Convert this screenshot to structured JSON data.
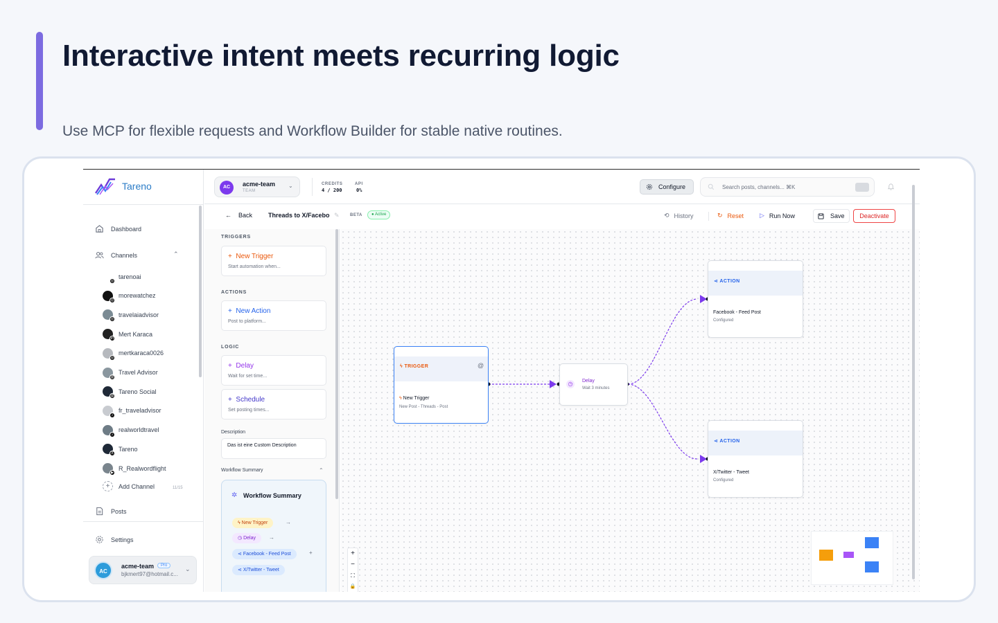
{
  "hero": {
    "headline": "Interactive intent meets recurring logic",
    "subline": "Use MCP for flexible requests and Workflow Builder for stable native routines."
  },
  "colors": {
    "accent": "#7c6be0",
    "brand": "#2b7cc7",
    "trigger": "#f97316",
    "action": "#2563eb",
    "logic": "#9333ea",
    "danger": "#dc2626",
    "connector": "#7c3aed"
  },
  "sidebar": {
    "brand": "Tareno",
    "nav": {
      "dashboard": "Dashboard",
      "channels": "Channels",
      "posts": "Posts",
      "settings": "Settings"
    },
    "channels": [
      {
        "name": "tarenoai",
        "badge": "instagram",
        "avatar_color": "#ffffff"
      },
      {
        "name": "morewatchez",
        "badge": "instagram",
        "avatar_color": "#111111"
      },
      {
        "name": "travelaiadvisor",
        "badge": "instagram",
        "avatar_color": "#7b8b94"
      },
      {
        "name": "Mert Karaca",
        "badge": "linkedin",
        "avatar_color": "#222222"
      },
      {
        "name": "mertkaraca0026",
        "badge": "instagram",
        "avatar_color": "#b6b9be"
      },
      {
        "name": "Travel Advisor",
        "badge": "threads",
        "avatar_color": "#8a979f"
      },
      {
        "name": "Tareno Social",
        "badge": "threads",
        "avatar_color": "#1f2937"
      },
      {
        "name": "fr_traveladvisor",
        "badge": "tiktok",
        "avatar_color": "#c8cbd0"
      },
      {
        "name": "realworldtravel",
        "badge": "tiktok",
        "avatar_color": "#6e7c86"
      },
      {
        "name": "Tareno",
        "badge": "x",
        "avatar_color": "#1f2937"
      },
      {
        "name": "R_Realwordflight",
        "badge": "youtube",
        "avatar_color": "#7a858d"
      }
    ],
    "add_channel": "Add Channel",
    "channel_count": "11/15",
    "account": {
      "initials": "AC",
      "name": "acme-team",
      "plan": "Pro",
      "email": "bjkmert97@hotmail.c..."
    }
  },
  "topbar": {
    "team": {
      "initials": "AC",
      "name": "acme-team",
      "sub": "TEAM"
    },
    "credits_label": "CREDITS",
    "credits_value": "4 / 200",
    "api_label": "API",
    "api_value": "0%",
    "configure": "Configure",
    "search_placeholder": "Search posts, channels... ⌘K"
  },
  "subbar": {
    "back": "Back",
    "title": "Threads to X/Facebo",
    "beta": "BETA",
    "status": "Active",
    "history": "History",
    "reset": "Reset",
    "run_now": "Run Now",
    "save": "Save",
    "deactivate": "Deactivate"
  },
  "palette": {
    "triggers_head": "TRIGGERS",
    "actions_head": "ACTIONS",
    "logic_head": "LOGIC",
    "new_trigger": {
      "title": "New Trigger",
      "sub": "Start automation when..."
    },
    "new_action": {
      "title": "New Action",
      "sub": "Post to platform..."
    },
    "delay": {
      "title": "Delay",
      "sub": "Wait for set time..."
    },
    "schedule": {
      "title": "Schedule",
      "sub": "Set posting times..."
    },
    "description_label": "Description",
    "description_value": "Das ist eine Custom Description",
    "summary_label": "Workflow Summary",
    "summary_title": "Workflow Summary",
    "chips": [
      "New Trigger",
      "Delay",
      "Facebook - Feed Post",
      "X/Twitter - Tweet"
    ]
  },
  "canvas": {
    "trigger_node": {
      "label": "TRIGGER",
      "title": "New Trigger",
      "sub": "New Post - Threads - Post"
    },
    "delay_node": {
      "title": "Delay",
      "sub": "Wait 3 minutes"
    },
    "action_fb": {
      "label": "ACTION",
      "title": "Facebook - Feed Post",
      "sub": "Configured"
    },
    "action_x": {
      "label": "ACTION",
      "title": "X/Twitter - Tweet",
      "sub": "Configured"
    },
    "zoom": [
      "+",
      "−",
      "⛶",
      "🔒"
    ]
  }
}
